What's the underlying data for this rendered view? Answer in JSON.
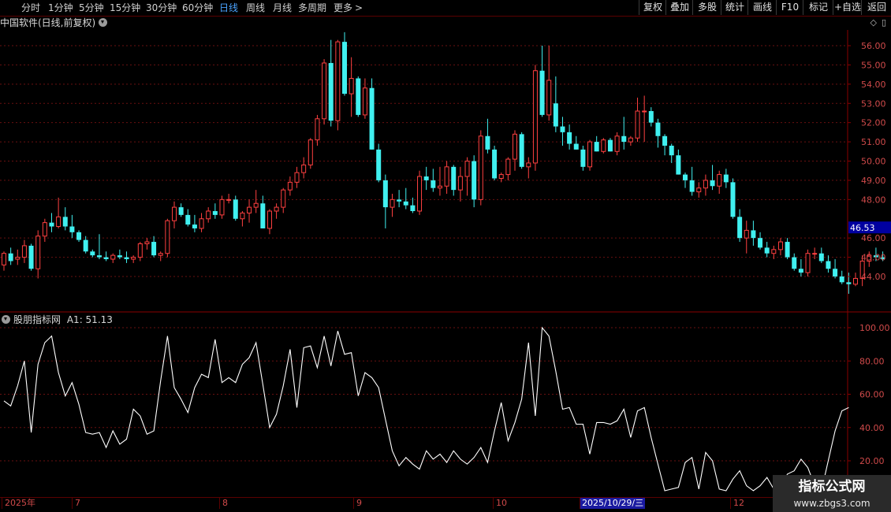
{
  "toolbar": {
    "periods": [
      {
        "label": "分时",
        "active": false
      },
      {
        "label": "1分钟",
        "active": false
      },
      {
        "label": "5分钟",
        "active": false
      },
      {
        "label": "15分钟",
        "active": false
      },
      {
        "label": "30分钟",
        "active": false
      },
      {
        "label": "60分钟",
        "active": false
      },
      {
        "label": "日线",
        "active": true
      },
      {
        "label": "周线",
        "active": false
      },
      {
        "label": "月线",
        "active": false
      },
      {
        "label": "多周期",
        "active": false
      },
      {
        "label": "更多",
        "active": false
      }
    ],
    "more_arrow": ">",
    "tools": [
      "复权",
      "叠加",
      "多股",
      "统计",
      "画线",
      "F10",
      "标记",
      "+自选",
      "返回"
    ]
  },
  "chart_header": {
    "title": "中国软件(日线,前复权)"
  },
  "window_icons": {
    "diamond": "◇",
    "panel": "▯"
  },
  "indicator": {
    "label": "股朋指标网",
    "value_text": "A1: 51.13"
  },
  "price_axis": {
    "ticks": [
      "56.00",
      "55.00",
      "54.00",
      "53.00",
      "52.00",
      "51.00",
      "50.00",
      "49.00",
      "48.00",
      "46.00",
      "45.00",
      "44.00"
    ],
    "current_price": "46.53"
  },
  "indicator_axis": {
    "ticks": [
      "100.00",
      "80.00",
      "60.00",
      "40.00",
      "20.00"
    ]
  },
  "date_axis": {
    "labels": [
      "2025年",
      "7",
      "8",
      "9",
      "10",
      "12"
    ],
    "cursor_date": "2025/10/29/三"
  },
  "watermark": {
    "title": "指标公式网",
    "url": "www.zbgs3.com"
  },
  "colors": {
    "up": "#ff4040",
    "down": "#40f0f0",
    "grid": "#6a1010",
    "line": "#ffffff",
    "axis_text": "#d04a4a",
    "current_price_bg": "#0000a0"
  },
  "chart_data": [
    {
      "type": "candlestick",
      "title": "中国软件(日线,前复权)",
      "ylim": [
        43,
        56.8
      ],
      "y_ticks": [
        56,
        55,
        54,
        53,
        52,
        51,
        50,
        49,
        48,
        46,
        45,
        44
      ],
      "current_price": 46.53,
      "x_markers": [
        "2025年",
        "7",
        "8",
        "9",
        "10",
        "12"
      ],
      "candles": [
        [
          44.6,
          45.3,
          44.3,
          45.2
        ],
        [
          45.2,
          45.5,
          44.6,
          44.8
        ],
        [
          44.9,
          45.4,
          44.6,
          45.0
        ],
        [
          45.0,
          45.9,
          44.7,
          45.6
        ],
        [
          45.6,
          45.7,
          44.3,
          44.4
        ],
        [
          44.4,
          46.4,
          43.9,
          46.1
        ],
        [
          46.1,
          47.0,
          45.8,
          46.8
        ],
        [
          46.8,
          47.3,
          46.3,
          46.6
        ],
        [
          46.6,
          48.1,
          46.5,
          47.1
        ],
        [
          47.1,
          47.6,
          46.4,
          46.6
        ],
        [
          46.6,
          47.2,
          46.0,
          46.3
        ],
        [
          46.3,
          46.4,
          45.8,
          45.9
        ],
        [
          45.9,
          46.1,
          45.2,
          45.3
        ],
        [
          45.3,
          45.4,
          45.0,
          45.1
        ],
        [
          45.1,
          46.2,
          44.9,
          45.0
        ],
        [
          45.0,
          45.3,
          44.8,
          44.9
        ],
        [
          44.9,
          45.2,
          44.7,
          45.1
        ],
        [
          45.1,
          45.4,
          44.9,
          45.0
        ],
        [
          45.0,
          45.3,
          44.7,
          44.9
        ],
        [
          44.9,
          45.1,
          44.7,
          45.0
        ],
        [
          45.0,
          45.8,
          44.8,
          45.7
        ],
        [
          45.7,
          46.0,
          45.4,
          45.8
        ],
        [
          45.8,
          46.1,
          45.0,
          45.1
        ],
        [
          45.1,
          45.3,
          44.8,
          45.2
        ],
        [
          45.2,
          47.0,
          45.0,
          46.9
        ],
        [
          46.9,
          47.9,
          46.5,
          47.6
        ],
        [
          47.6,
          47.8,
          47.1,
          47.2
        ],
        [
          47.2,
          47.5,
          46.6,
          46.7
        ],
        [
          46.7,
          47.2,
          46.3,
          46.5
        ],
        [
          46.5,
          47.3,
          46.3,
          47.0
        ],
        [
          47.0,
          47.6,
          46.8,
          47.4
        ],
        [
          47.4,
          47.8,
          47.0,
          47.2
        ],
        [
          47.2,
          48.2,
          47.0,
          48.0
        ],
        [
          48.0,
          48.3,
          47.8,
          48.0
        ],
        [
          48.0,
          48.2,
          46.9,
          47.0
        ],
        [
          47.0,
          47.4,
          46.6,
          47.3
        ],
        [
          47.3,
          48.0,
          46.8,
          47.6
        ],
        [
          47.6,
          48.5,
          47.3,
          47.8
        ],
        [
          47.8,
          48.2,
          46.5,
          46.5
        ],
        [
          46.5,
          47.5,
          46.2,
          47.4
        ],
        [
          47.4,
          47.8,
          47.0,
          47.6
        ],
        [
          47.6,
          48.6,
          47.3,
          48.5
        ],
        [
          48.5,
          49.2,
          48.2,
          48.9
        ],
        [
          48.9,
          49.7,
          48.6,
          49.4
        ],
        [
          49.4,
          50.2,
          49.1,
          49.8
        ],
        [
          49.8,
          51.2,
          49.6,
          51.1
        ],
        [
          51.1,
          52.4,
          50.8,
          52.2
        ],
        [
          52.2,
          55.3,
          51.9,
          55.1
        ],
        [
          55.1,
          56.3,
          51.8,
          52.1
        ],
        [
          52.1,
          56.3,
          51.6,
          56.2
        ],
        [
          56.2,
          56.7,
          53.4,
          53.5
        ],
        [
          53.5,
          55.4,
          52.3,
          54.3
        ],
        [
          54.3,
          54.4,
          52.3,
          52.4
        ],
        [
          52.4,
          54.3,
          52.2,
          53.8
        ],
        [
          53.8,
          54.3,
          50.6,
          50.6
        ],
        [
          50.6,
          50.9,
          48.9,
          49.0
        ],
        [
          49.0,
          49.3,
          46.5,
          47.6
        ],
        [
          47.6,
          48.3,
          47.1,
          48.0
        ],
        [
          48.0,
          48.5,
          47.6,
          47.9
        ],
        [
          47.9,
          48.6,
          47.5,
          47.7
        ],
        [
          47.7,
          48.1,
          47.3,
          47.4
        ],
        [
          47.4,
          49.5,
          47.2,
          49.2
        ],
        [
          49.2,
          49.7,
          48.5,
          49.0
        ],
        [
          49.0,
          49.6,
          48.4,
          48.6
        ],
        [
          48.6,
          49.7,
          48.2,
          48.7
        ],
        [
          48.7,
          50.0,
          48.3,
          49.7
        ],
        [
          49.7,
          49.8,
          48.2,
          48.5
        ],
        [
          48.5,
          49.7,
          47.9,
          49.2
        ],
        [
          49.2,
          50.2,
          48.2,
          50.0
        ],
        [
          50.0,
          50.3,
          47.6,
          48.0
        ],
        [
          48.0,
          51.6,
          47.7,
          51.3
        ],
        [
          51.3,
          52.2,
          50.4,
          50.6
        ],
        [
          50.6,
          50.8,
          49.0,
          49.1
        ],
        [
          49.1,
          49.4,
          48.9,
          49.3
        ],
        [
          49.3,
          50.2,
          49.0,
          50.1
        ],
        [
          50.1,
          51.6,
          49.5,
          51.4
        ],
        [
          51.4,
          51.5,
          49.6,
          49.7
        ],
        [
          49.7,
          50.2,
          49.1,
          49.9
        ],
        [
          49.9,
          55.0,
          49.5,
          54.7
        ],
        [
          54.7,
          56.0,
          52.3,
          52.4
        ],
        [
          52.4,
          56.0,
          52.1,
          54.2
        ],
        [
          53.0,
          54.4,
          51.5,
          51.8
        ],
        [
          51.8,
          52.3,
          50.8,
          51.5
        ],
        [
          51.5,
          51.9,
          50.6,
          50.9
        ],
        [
          50.9,
          51.3,
          50.6,
          50.6
        ],
        [
          50.6,
          50.8,
          49.5,
          49.7
        ],
        [
          49.7,
          51.1,
          49.5,
          51.0
        ],
        [
          51.0,
          51.3,
          50.5,
          50.5
        ],
        [
          50.5,
          51.2,
          50.4,
          51.1
        ],
        [
          51.1,
          51.2,
          50.5,
          50.5
        ],
        [
          50.5,
          51.5,
          50.3,
          51.3
        ],
        [
          51.3,
          52.3,
          50.6,
          51.0
        ],
        [
          51.0,
          51.3,
          50.8,
          51.2
        ],
        [
          51.2,
          53.3,
          51.0,
          52.6
        ],
        [
          52.6,
          53.4,
          51.0,
          52.6
        ],
        [
          52.6,
          52.8,
          51.8,
          52.0
        ],
        [
          52.0,
          52.2,
          50.7,
          51.3
        ],
        [
          51.3,
          51.4,
          50.3,
          50.8
        ],
        [
          50.8,
          50.9,
          49.9,
          50.3
        ],
        [
          50.3,
          50.6,
          49.3,
          49.3
        ],
        [
          49.3,
          49.4,
          48.6,
          49.0
        ],
        [
          49.0,
          49.7,
          48.2,
          48.4
        ],
        [
          48.4,
          48.9,
          48.1,
          48.6
        ],
        [
          48.6,
          49.3,
          48.2,
          49.0
        ],
        [
          49.0,
          49.8,
          48.5,
          48.7
        ],
        [
          48.7,
          49.5,
          48.3,
          49.3
        ],
        [
          49.3,
          49.6,
          48.6,
          48.9
        ],
        [
          48.9,
          49.1,
          47.0,
          47.1
        ],
        [
          47.1,
          47.5,
          45.8,
          46.0
        ],
        [
          46.0,
          46.9,
          45.2,
          46.4
        ],
        [
          46.4,
          46.9,
          45.6,
          46.0
        ],
        [
          46.0,
          46.3,
          45.4,
          45.5
        ],
        [
          45.5,
          45.8,
          45.0,
          45.2
        ],
        [
          45.2,
          45.6,
          44.9,
          45.4
        ],
        [
          45.4,
          46.0,
          45.1,
          45.8
        ],
        [
          45.8,
          46.0,
          44.9,
          45.0
        ],
        [
          45.0,
          45.2,
          44.3,
          44.4
        ],
        [
          44.4,
          44.9,
          44.0,
          44.2
        ],
        [
          44.2,
          45.4,
          44.0,
          45.2
        ],
        [
          45.2,
          45.5,
          44.9,
          45.2
        ],
        [
          45.2,
          45.5,
          44.7,
          44.8
        ],
        [
          44.8,
          45.1,
          44.2,
          44.4
        ],
        [
          44.4,
          44.9,
          43.9,
          44.0
        ],
        [
          44.0,
          44.3,
          43.6,
          43.7
        ],
        [
          43.7,
          44.2,
          43.1,
          43.6
        ],
        [
          43.6,
          44.2,
          43.5,
          43.9
        ],
        [
          43.9,
          45.1,
          43.5,
          44.8
        ],
        [
          44.8,
          45.3,
          44.5,
          45.1
        ],
        [
          45.1,
          45.5,
          44.8,
          45.0
        ],
        [
          45.0,
          45.3,
          44.8,
          44.9
        ]
      ]
    },
    {
      "type": "line",
      "title": "股朋指标网",
      "ylim": [
        0,
        112
      ],
      "y_ticks": [
        100,
        80,
        60,
        40,
        20
      ],
      "last_value": 51.13,
      "values": [
        56,
        53,
        65,
        80,
        37,
        78,
        91,
        95,
        73,
        59,
        67,
        54,
        37,
        36,
        37,
        28,
        38,
        30,
        33,
        51,
        47,
        36,
        38,
        68,
        95,
        64,
        57,
        49,
        64,
        72,
        70,
        93,
        67,
        70,
        67,
        78,
        82,
        91,
        66,
        40,
        48,
        65,
        87,
        52,
        88,
        89,
        76,
        95,
        77,
        98,
        84,
        85,
        59,
        73,
        70,
        64,
        45,
        26,
        17,
        22,
        18,
        15,
        26,
        21,
        24,
        19,
        26,
        21,
        18,
        22,
        28,
        19,
        38,
        55,
        32,
        43,
        57,
        91,
        47,
        100,
        95,
        74,
        51,
        52,
        42,
        42,
        24,
        43,
        43,
        42,
        44,
        51,
        34,
        50,
        52,
        34,
        18,
        2,
        3,
        4,
        19,
        22,
        3,
        25,
        20,
        3,
        2,
        9,
        14,
        5,
        2,
        5,
        10,
        3,
        4,
        12,
        14,
        21,
        16,
        5,
        2,
        20,
        38,
        50,
        52
      ]
    }
  ]
}
